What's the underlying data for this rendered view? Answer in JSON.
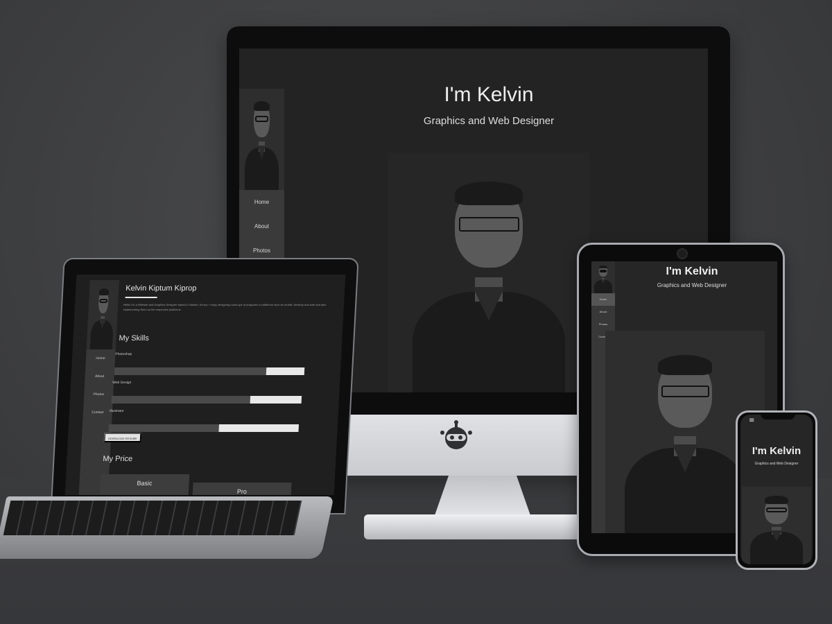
{
  "desktop": {
    "title": "I'm Kelvin",
    "subtitle": "Graphics and Web Designer",
    "nav": [
      "Home",
      "About",
      "Photos"
    ],
    "logo_icon": "robot-icon"
  },
  "laptop": {
    "name": "Kelvin Kiptum Kiprop",
    "intro": "Hello! I'm a Website and Graphics Designer based in Nairobi, Kenya. I enjoy designing mock-ups of programs in platforms such as mobile, desktop and web and also implementing them on the respective platforms.",
    "nav": [
      "Home",
      "About",
      "Photos",
      "Contact"
    ],
    "skills_heading": "My Skills",
    "skills": [
      {
        "label": "Photoshop",
        "level": 0.2
      },
      {
        "label": "Web Design",
        "level": 0.27
      },
      {
        "label": "Illustrator",
        "level": 0.42
      }
    ],
    "download_label": "DOWNLOAD RESUME",
    "price_heading": "My Price",
    "plans": [
      "Basic",
      "Pro"
    ]
  },
  "tablet": {
    "title": "I'm Kelvin",
    "subtitle": "Graphics and Web Designer",
    "nav": [
      "Home",
      "About",
      "Photos",
      "Contact"
    ]
  },
  "phone": {
    "menu_icon": "≡",
    "title": "I'm Kelvin",
    "subtitle": "Graphics and Web Designer"
  },
  "colors": {
    "background": "#3d3e40",
    "screen_bg": "#232324",
    "sidebar_bg": "#3a3a3b",
    "skill_fill": "#e8e8e8"
  }
}
